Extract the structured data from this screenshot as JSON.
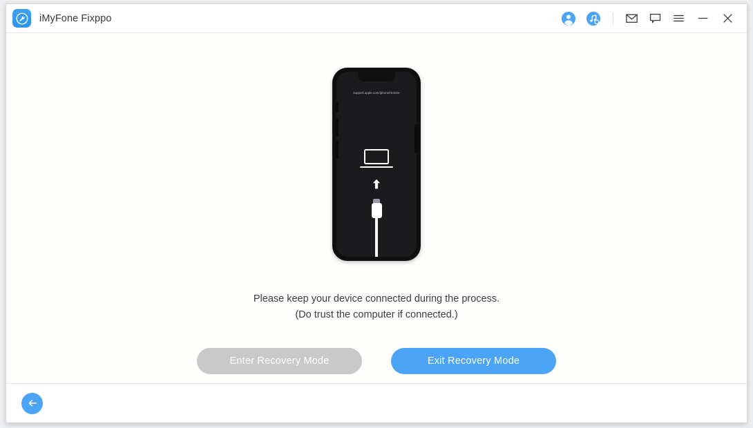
{
  "window": {
    "app_title": "iMyFone Fixppo",
    "logo_icon": "wrench-logo-icon"
  },
  "titlebar": {
    "icons": [
      {
        "name": "account-icon",
        "label": "Account"
      },
      {
        "name": "music-search-icon",
        "label": "Music Search"
      },
      {
        "name": "mail-icon",
        "label": "Mail"
      },
      {
        "name": "feedback-icon",
        "label": "Feedback"
      },
      {
        "name": "menu-icon",
        "label": "Menu"
      },
      {
        "name": "minimize-icon",
        "label": "Minimize"
      },
      {
        "name": "close-icon",
        "label": "Close"
      }
    ]
  },
  "device": {
    "recovery_url": "support.apple.com/iphone/restore",
    "laptop_icon": "laptop-icon",
    "arrow_icon": "up-arrow-icon",
    "cable_icon": "lightning-cable-icon"
  },
  "main": {
    "message_line1": "Please keep your device connected during the process.",
    "message_line2": "(Do trust the computer if connected.)",
    "enter_button_label": "Enter Recovery Mode",
    "exit_button_label": "Exit Recovery Mode"
  },
  "footer": {
    "back_icon": "back-arrow-icon"
  },
  "colors": {
    "accent_blue": "#4BA4F5",
    "disabled_grey": "#C9C9C9",
    "phone_black": "#101010",
    "cable_tip": "#9B98AD"
  }
}
